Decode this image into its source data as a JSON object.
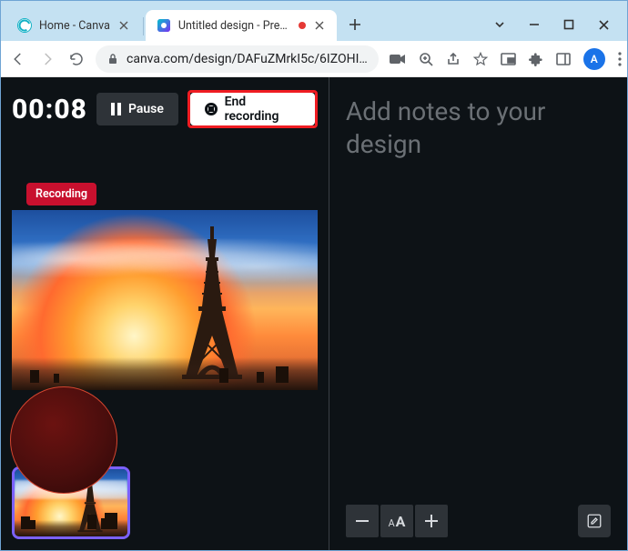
{
  "tabs": [
    {
      "title": "Home - Canva",
      "active": false
    },
    {
      "title": "Untitled design - Prese",
      "active": true
    }
  ],
  "new_tab_icon": "plus-icon",
  "window_controls": {
    "dropdown": "chevron-down-icon",
    "minimize": "minimize-icon",
    "maximize": "maximize-icon",
    "close": "close-icon"
  },
  "toolbar": {
    "url": "canva.com/design/DAFuZMrkI5c/6IZOHI…",
    "avatar_initial": "A"
  },
  "recorder": {
    "timer": "00:08",
    "pause_label": "Pause",
    "end_label": "End recording",
    "badge": "Recording"
  },
  "notes": {
    "placeholder": "Add notes to your design"
  }
}
